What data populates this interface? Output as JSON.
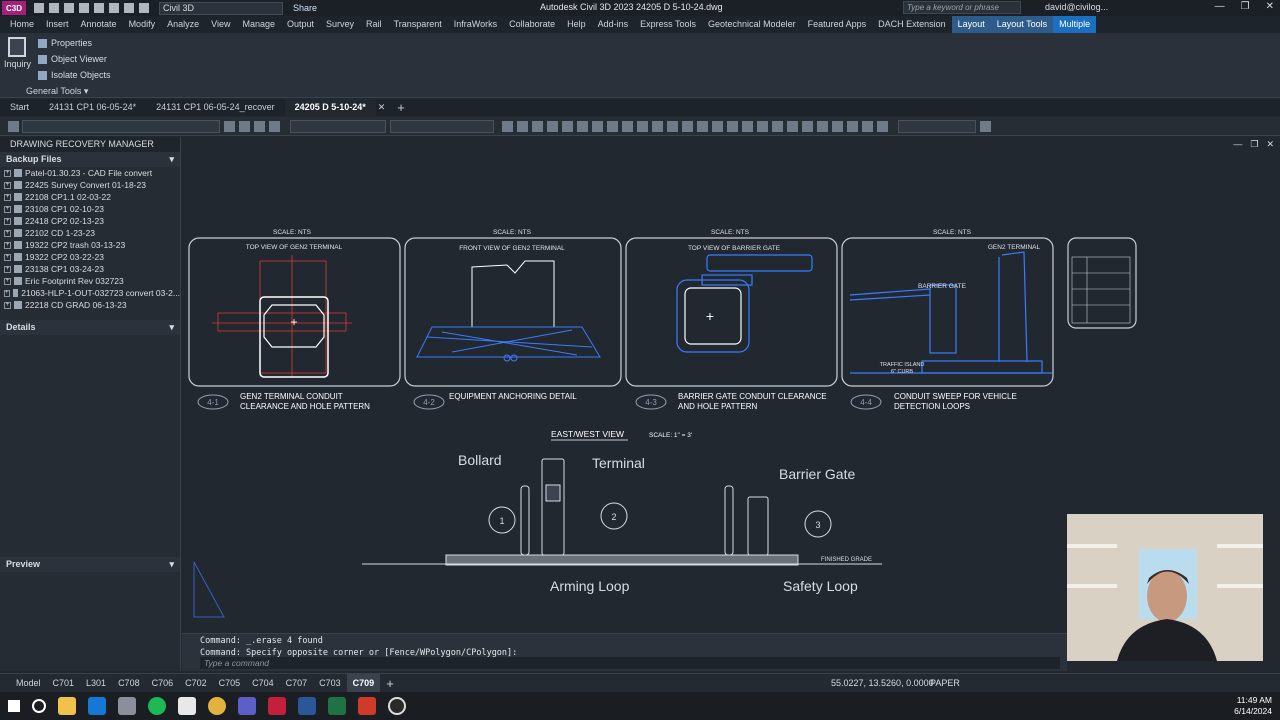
{
  "titlebar": {
    "app_logo": "C3D",
    "workspace": "Civil 3D",
    "share": "Share",
    "title": "Autodesk Civil 3D 2023    24205 D 5-10-24.dwg",
    "search_placeholder": "Type a keyword or phrase",
    "user": "david@civilog..."
  },
  "menu": [
    "Home",
    "Insert",
    "Annotate",
    "Modify",
    "Analyze",
    "View",
    "Manage",
    "Output",
    "Survey",
    "Rail",
    "Transparent",
    "InfraWorks",
    "Collaborate",
    "Help",
    "Add-ins",
    "Express Tools",
    "Geotechnical Modeler",
    "Featured Apps",
    "DACH Extension",
    "Layout",
    "Layout Tools",
    "Multiple"
  ],
  "ribbon": {
    "inquiry": "Inquiry",
    "properties": "Properties",
    "object_viewer": "Object Viewer",
    "isolate_objects": "Isolate Objects",
    "panel": "General Tools ▾"
  },
  "doctabs": [
    "Start",
    "24131 CP1 06-05-24*",
    "24131 CP1 06-05-24_recover",
    "24205 D 5-10-24*"
  ],
  "drm": {
    "title": "DRAWING RECOVERY MANAGER",
    "backup_files": "Backup Files",
    "files": [
      "Patel-01.30.23 - CAD File convert",
      "22425 Survey Convert 01-18-23",
      "22108 CP1.1 02-03-22",
      "23108 CP1 02-10-23",
      "22418 CP2 02-13-23",
      "22102 CD 1-23-23",
      "19322 CP2 trash 03-13-23",
      "19322 CP2 03-22-23",
      "23138 CP1 03-24-23",
      "Eric Footprint Rev 032723",
      "21063-HLP-1-OUT-032723 convert 03-2...",
      "22218 CD GRAD 06-13-23"
    ],
    "details": "Details",
    "preview": "Preview"
  },
  "drawing": {
    "scale_nts": "SCALE: NTS",
    "details": [
      {
        "view": "TOP VIEW OF GEN2 TERMINAL",
        "num": "4-1",
        "caption1": "GEN2 TERMINAL CONDUIT",
        "caption2": "CLEARANCE AND HOLE PATTERN"
      },
      {
        "view": "FRONT VIEW OF GEN2 TERMINAL",
        "num": "4-2",
        "caption1": "EQUIPMENT ANCHORING DETAIL",
        "caption2": ""
      },
      {
        "view": "TOP VIEW OF BARRIER GATE",
        "num": "4-3",
        "caption1": "BARRIER GATE  CONDUIT CLEARANCE",
        "caption2": "AND HOLE PATTERN"
      },
      {
        "view": "GEN2 TERMINAL",
        "num": "4-4",
        "caption1": "CONDUIT SWEEP FOR VEHICLE",
        "caption2": "DETECTION LOOPS"
      }
    ],
    "barrier_gate_label": "BARRIER GATE",
    "traffic_island": "TRAFFIC ISLAND",
    "curb": "6\" CURB",
    "east_west": "EAST/WEST VIEW",
    "east_west_scale": "SCALE: 1\" = 3'",
    "bollard": "Bollard",
    "terminal": "Terminal",
    "barrier_gate": "Barrier Gate",
    "arming_loop": "Arming Loop",
    "safety_loop": "Safety Loop",
    "finished_grade": "FINISHED GRADE",
    "callouts": [
      "1",
      "2",
      "3"
    ]
  },
  "command": {
    "line1": "Command: _.erase 4 found",
    "line2": "Command: Specify opposite corner or [Fence/WPolygon/CPolygon]:",
    "placeholder": "Type a command"
  },
  "layouts": [
    "Model",
    "C701",
    "L301",
    "C708",
    "C706",
    "C702",
    "C705",
    "C704",
    "C707",
    "C703",
    "C709"
  ],
  "status": {
    "coords": "55.0227, 13.5260, 0.0000",
    "paper": "PAPER"
  },
  "clock": {
    "time": "11:49 AM",
    "date": "6/14/2024"
  },
  "colors": {
    "accent": "#1a6fc0",
    "blue_lines": "#3a7bff",
    "red_lines": "#d83a3a",
    "canvas": "#212830"
  }
}
